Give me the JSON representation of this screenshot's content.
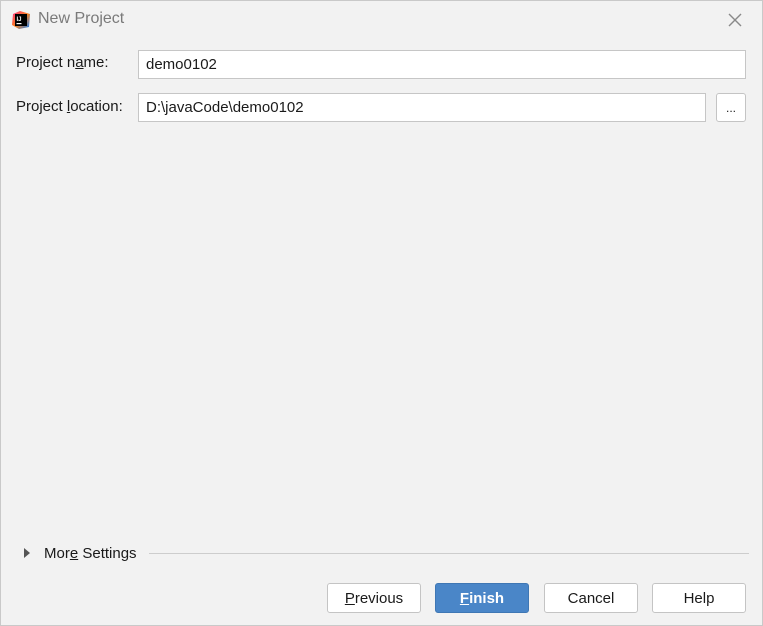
{
  "window": {
    "title": "New Project"
  },
  "form": {
    "name_label_pre": "Project n",
    "name_label_mnemonic": "a",
    "name_label_post": "me:",
    "name_value": "demo0102",
    "location_label_pre": "Project ",
    "location_label_mnemonic": "l",
    "location_label_post": "ocation:",
    "location_value": "D:\\javaCode\\demo0102",
    "browse_label": "..."
  },
  "more_settings": {
    "label_pre": "Mor",
    "label_mnemonic": "e",
    "label_post": " Settings"
  },
  "buttons": {
    "previous_mnemonic": "P",
    "previous_rest": "revious",
    "finish_mnemonic": "F",
    "finish_rest": "inish",
    "cancel_label": "Cancel",
    "help_label": "Help"
  },
  "colors": {
    "primary_button": "#4a86c8",
    "background": "#f2f2f2",
    "app_icon_bg": "#1e1e2e",
    "app_icon_accent": "#ff318c"
  }
}
